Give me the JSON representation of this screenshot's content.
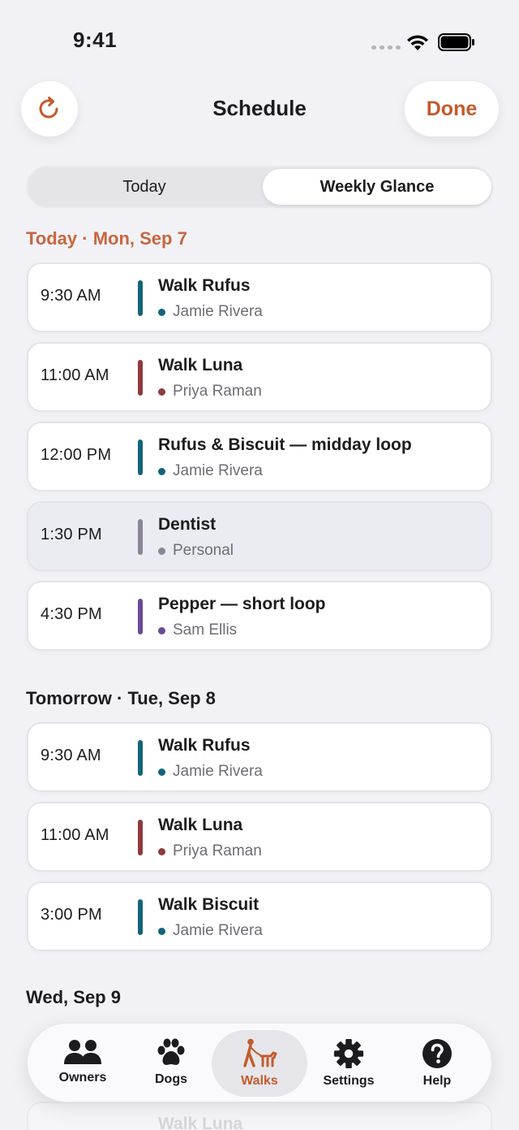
{
  "status_bar": {
    "time": "9:41"
  },
  "nav": {
    "title": "Schedule",
    "done_label": "Done",
    "refresh_icon": "refresh-icon"
  },
  "segmented": {
    "today_label": "Today",
    "weekly_label": "Weekly Glance",
    "selected": "Weekly Glance"
  },
  "colors": {
    "accent": "#c45a2c",
    "teal": "#13647a",
    "maroon": "#8e3a3d",
    "gray": "#8a8597",
    "purple": "#6b4a94"
  },
  "sections": [
    {
      "header": "Today · Mon, Sep 7",
      "items": [
        {
          "time": "9:30 AM",
          "title": "Walk Rufus",
          "owner": "Jamie Rivera",
          "color": "#13647a"
        },
        {
          "time": "11:00 AM",
          "title": "Walk Luna",
          "owner": "Priya Raman",
          "color": "#8e3a3d"
        },
        {
          "time": "12:00 PM",
          "title": "Rufus & Biscuit — midday loop",
          "owner": "Jamie Rivera",
          "color": "#13647a"
        },
        {
          "time": "1:30 PM",
          "title": "Dentist",
          "owner": "Personal",
          "color": "#8a8597"
        },
        {
          "time": "4:30 PM",
          "title": "Pepper — short loop",
          "owner": "Sam Ellis",
          "color": "#6b4a94"
        }
      ]
    },
    {
      "header": "Tomorrow · Tue, Sep 8",
      "items": [
        {
          "time": "9:30 AM",
          "title": "Walk Rufus",
          "owner": "Jamie Rivera",
          "color": "#13647a"
        },
        {
          "time": "11:00 AM",
          "title": "Walk Luna",
          "owner": "Priya Raman",
          "color": "#8e3a3d"
        },
        {
          "time": "3:00 PM",
          "title": "Walk Biscuit",
          "owner": "Jamie Rivera",
          "color": "#13647a"
        }
      ]
    },
    {
      "header": "Wed, Sep 9",
      "peek_title": "Walk Luna"
    }
  ],
  "tab_bar": {
    "tabs": [
      {
        "label": "Owners",
        "icon": "people-icon"
      },
      {
        "label": "Dogs",
        "icon": "paw-icon"
      },
      {
        "label": "Walks",
        "icon": "dog-walker-icon"
      },
      {
        "label": "Settings",
        "icon": "gear-icon"
      },
      {
        "label": "Help",
        "icon": "question-icon"
      }
    ],
    "selected": "Walks"
  }
}
